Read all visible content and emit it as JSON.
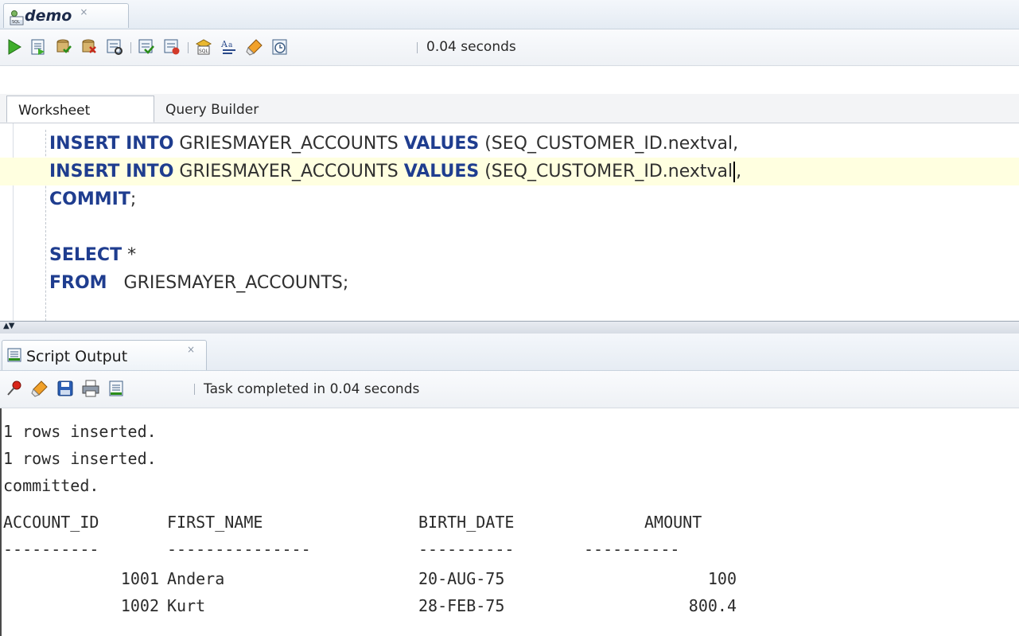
{
  "document_tab": {
    "label": "demo",
    "close": "×"
  },
  "toolbar": {
    "timing": "0.04 seconds",
    "icons": [
      "run-statement-icon",
      "run-script-icon",
      "commit-icon",
      "rollback-icon",
      "autotrace-icon",
      "explain-plan-icon",
      "sql-tuning-icon",
      "sql-history-icon",
      "format-icon",
      "clear-icon",
      "sql-monitor-icon"
    ]
  },
  "sub_tabs": {
    "worksheet": "Worksheet",
    "query_builder": "Query Builder"
  },
  "editor": {
    "lines": [
      {
        "kw1": "INSERT INTO",
        "t1": " GRIESMAYER_ACCOUNTS ",
        "kw2": "VALUES",
        "t2": " (SEQ_CUSTOMER_ID.nextval,",
        "current": false
      },
      {
        "kw1": "INSERT INTO",
        "t1": " GRIESMAYER_ACCOUNTS ",
        "kw2": "VALUES",
        "t2": " (SEQ_CUSTOMER_ID.nextval",
        "t3": ",",
        "current": true
      },
      {
        "kw1": "COMMIT",
        "t1": ";"
      },
      {
        "kw1": "SELECT",
        "t1": " *"
      },
      {
        "kw1": "FROM",
        "t1": "   GRIESMAYER_ACCOUNTS;"
      }
    ]
  },
  "output_tab": {
    "label": "Script Output",
    "close": "×"
  },
  "output_toolbar": {
    "status": "Task completed in 0.04 seconds"
  },
  "console": {
    "messages": [
      "1 rows inserted.",
      "1 rows inserted.",
      "committed."
    ],
    "headers": [
      "ACCOUNT_ID",
      "FIRST_NAME",
      "BIRTH_DATE",
      "AMOUNT"
    ],
    "dividers": [
      "----------",
      "---------------",
      "----------",
      "----------"
    ],
    "rows": [
      [
        "1001",
        "Andera",
        "20-AUG-75",
        "100"
      ],
      [
        "1002",
        "Kurt",
        "28-FEB-75",
        "800.4"
      ]
    ]
  },
  "colors": {
    "keyword": "#1f3d8f",
    "current_line": "#ffffe0",
    "text": "#303030"
  }
}
